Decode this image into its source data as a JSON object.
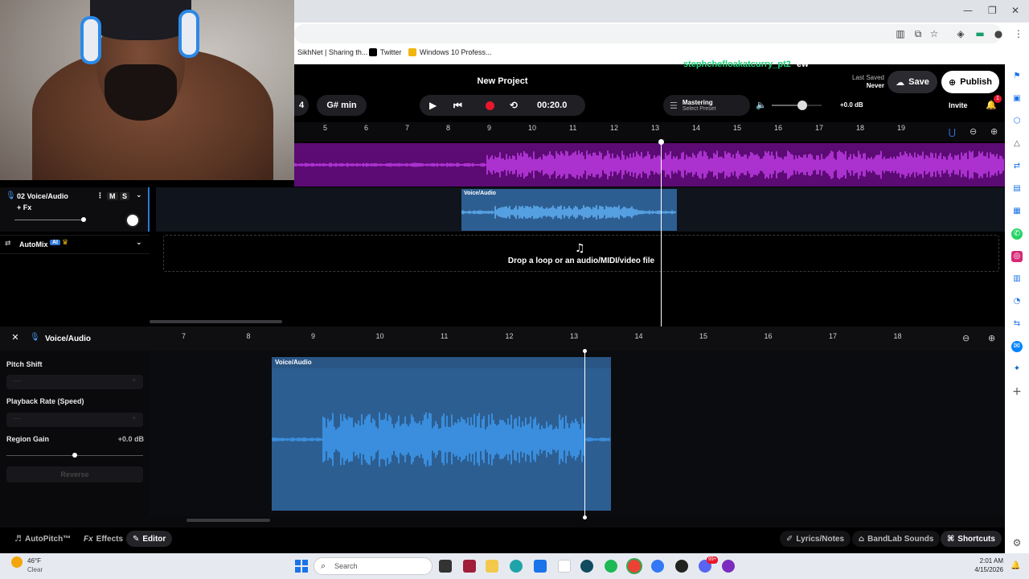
{
  "browser": {
    "bookmarks": [
      "SikhNet | Sharing th...",
      "Twitter",
      "Windows 10 Profess..."
    ]
  },
  "header": {
    "project_title": "New Project",
    "overlay_text": "stephchefloakatcurry_pt2",
    "overlay_suffix": "ew",
    "last_saved_label": "Last Saved",
    "last_saved_value": "Never",
    "save_label": "Save",
    "publish_label": "Publish",
    "invite_label": "Invite",
    "notification_count": "1"
  },
  "transport": {
    "bpm_partial": "4",
    "key": "G# min",
    "time": "00:20.0",
    "mastering_title": "Mastering",
    "mastering_sub": "Select Preset",
    "volume_db": "+0.0 dB",
    "volume_level": 0.62
  },
  "ruler_top": [
    "5",
    "6",
    "7",
    "8",
    "9",
    "10",
    "11",
    "12",
    "13",
    "14",
    "15",
    "16",
    "17",
    "18",
    "19"
  ],
  "tracks": {
    "track2_name": "02  Voice/Audio",
    "track2_fx": "+ Fx",
    "mute": "M",
    "solo": "S",
    "region_label": "Voice/Audio",
    "automix_label": "AutoMix",
    "ai_badge": "AI",
    "drop_text": "Drop a loop or an audio/MIDI/video file"
  },
  "editor": {
    "title": "Voice/Audio",
    "pitch_shift_label": "Pitch Shift",
    "playback_rate_label": "Playback Rate (Speed)",
    "region_gain_label": "Region Gain",
    "region_gain_value": "+0.0 dB",
    "reverse_label": "Reverse",
    "region_label": "Voice/Audio",
    "ruler": [
      "7",
      "8",
      "9",
      "10",
      "11",
      "12",
      "13",
      "14",
      "15",
      "16",
      "17",
      "18"
    ]
  },
  "footer": {
    "autopitch": "AutoPitch™",
    "effects": "Effects",
    "editor": "Editor",
    "lyrics": "Lyrics/Notes",
    "sounds": "BandLab Sounds",
    "shortcuts": "Shortcuts"
  },
  "taskbar": {
    "weather_temp": "46°F",
    "weather_desc": "Clear",
    "search_placeholder": "Search",
    "time": "2:01 AM",
    "date": "4/15/2026",
    "chat_badge": "99+"
  },
  "colors": {
    "accent_purple": "#5b0b73",
    "region_blue": "#2d5e92",
    "wave_blue": "#3d9bf0",
    "record_red": "#e8172c",
    "overlay_green": "#1fd37a"
  }
}
